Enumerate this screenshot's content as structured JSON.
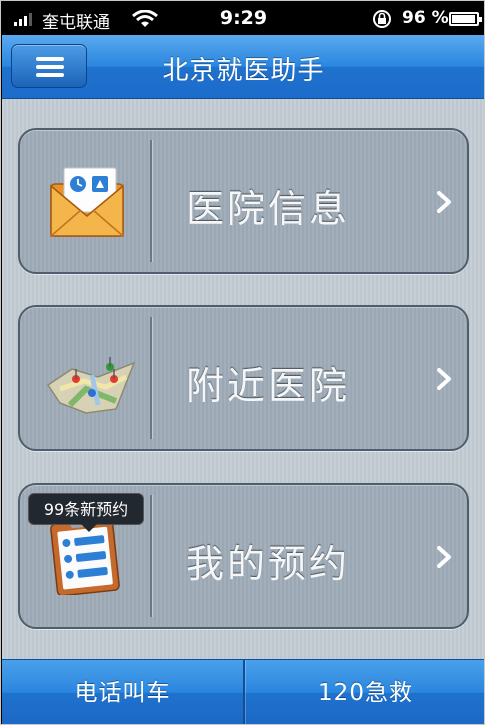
{
  "status_bar": {
    "carrier": "奎屯联通",
    "time": "9:29",
    "battery_percent": "96 %",
    "battery_level": 0.96
  },
  "nav": {
    "title": "北京就医助手"
  },
  "menu": {
    "items": [
      {
        "label": "医院信息",
        "icon": "envelope-icon"
      },
      {
        "label": "附近医院",
        "icon": "map-icon"
      },
      {
        "label": "我的预约",
        "icon": "clipboard-icon"
      }
    ],
    "badge": "99条新预约"
  },
  "bottom_bar": {
    "tabs": [
      "电话叫车",
      "120急救"
    ]
  },
  "colors": {
    "nav_blue": "#2a86de",
    "card_gray": "#a3afbb"
  }
}
